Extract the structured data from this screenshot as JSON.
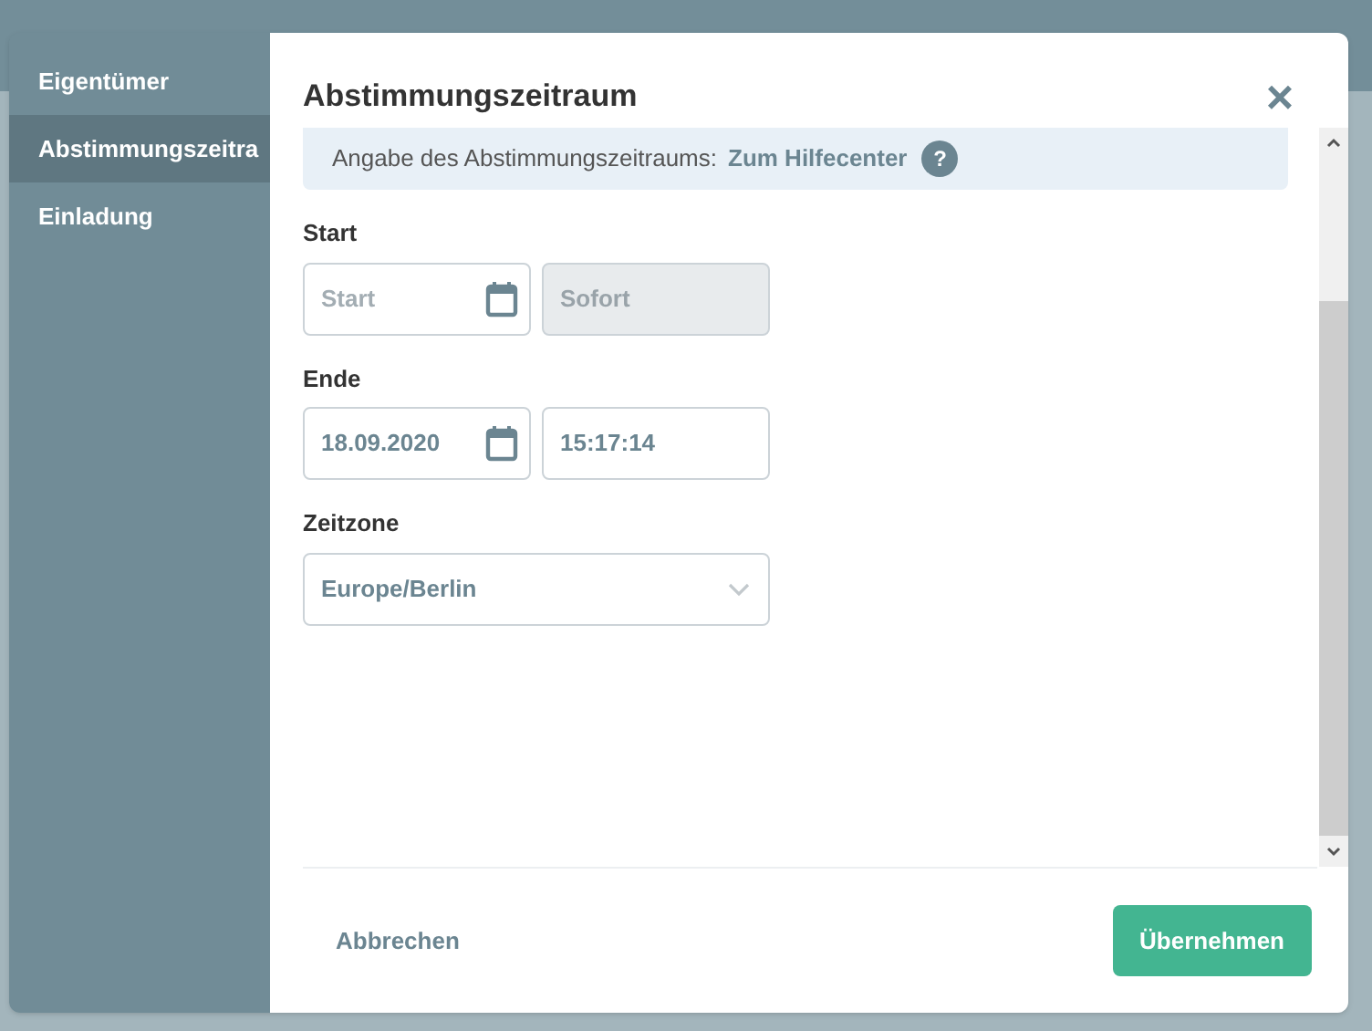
{
  "sidebar": {
    "items": [
      {
        "label": "Eigentümer",
        "selected": false
      },
      {
        "label": "Abstimmungszeitra",
        "selected": true
      },
      {
        "label": "Einladung",
        "selected": false
      }
    ]
  },
  "dialog": {
    "title": "Abstimmungszeitraum",
    "close": "×",
    "info": {
      "text": "Angabe des Abstimmungszeitraums:",
      "link": "Zum Hilfecenter",
      "help": "?"
    },
    "fields": [
      {
        "label": "Start",
        "date": {
          "placeholder": "Start"
        },
        "time": {
          "placeholder": "Sofort",
          "disabled": true
        }
      },
      {
        "label": "Ende",
        "date": {
          "value": "18.09.2020"
        },
        "time": {
          "value": "15:17:14",
          "disabled": false
        }
      }
    ],
    "timezone": {
      "label": "Zeitzone",
      "value": "Europe/Berlin"
    },
    "buttons": {
      "cancel": "Abbrechen",
      "apply": "Übernehmen"
    }
  }
}
